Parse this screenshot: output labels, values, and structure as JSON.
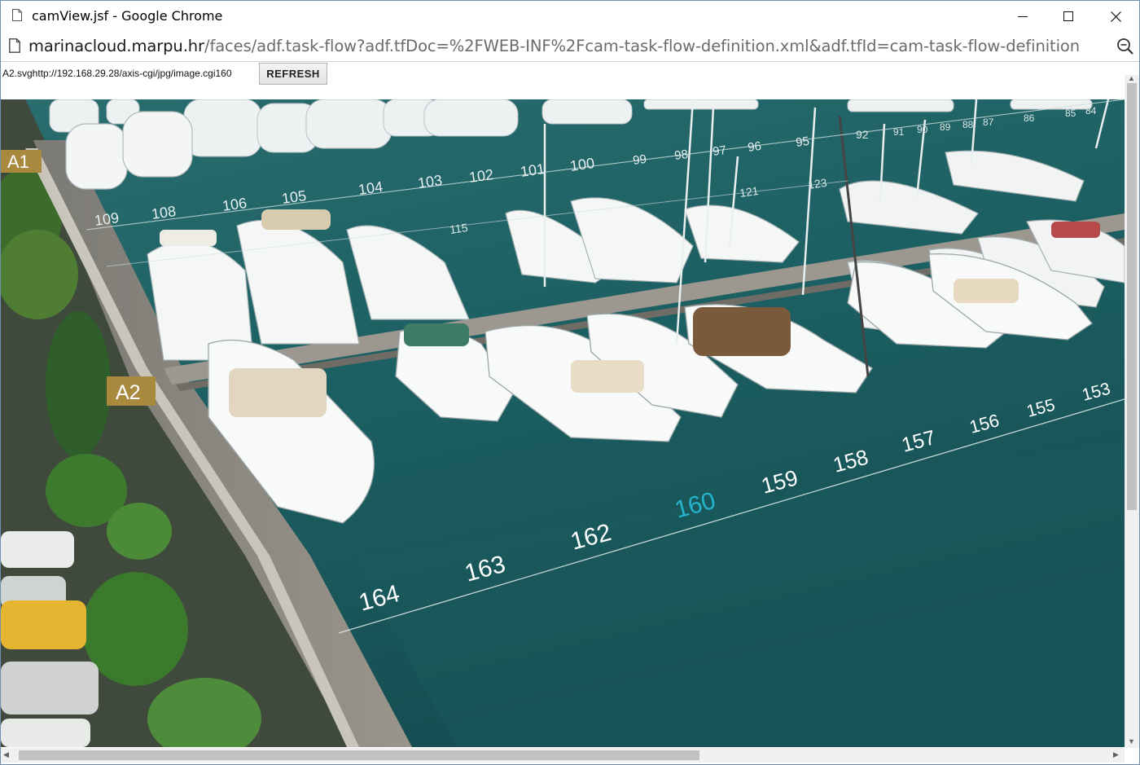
{
  "window": {
    "title": "camView.jsf - Google Chrome"
  },
  "address_bar": {
    "host": "marinacloud.marpu.hr",
    "path": "/faces/adf.task-flow?adf.tfDoc=%2FWEB-INF%2Fcam-task-flow-definition.xml&adf.tfId=cam-task-flow-definition"
  },
  "toolbar": {
    "path_label": "A2.svghttp://192.168.29.28/axis-cgi/jpg/image.cgi160",
    "refresh_label": "REFRESH"
  },
  "camera": {
    "zones": [
      "A1",
      "A2"
    ],
    "berths_front": [
      "164",
      "163",
      "162",
      "160",
      "159",
      "158",
      "157",
      "156",
      "155",
      "153"
    ],
    "berths_mid": [
      "109",
      "108",
      "106",
      "105",
      "104",
      "103",
      "102",
      "101",
      "100",
      "99",
      "98",
      "97",
      "96",
      "95"
    ],
    "berths_inner": [
      "115",
      "121",
      "123"
    ],
    "berths_far": [
      "92",
      "91",
      "90",
      "89",
      "88",
      "87",
      "86",
      "85",
      "84"
    ],
    "highlighted_berth": "160",
    "colors": {
      "water": "#1c5f62",
      "zone_badge": "#a8893e",
      "highlight": "#25b4cc",
      "berth_text": "#ffffff"
    }
  }
}
